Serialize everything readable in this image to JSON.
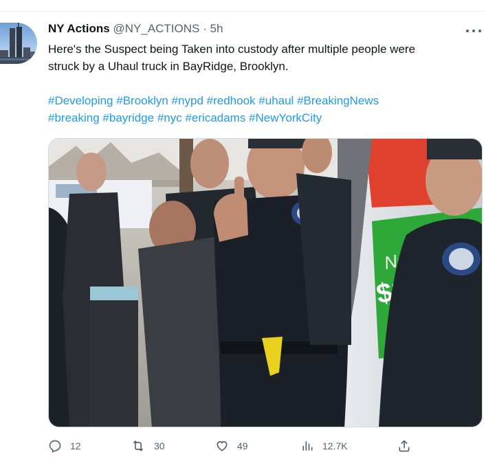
{
  "tweet": {
    "author": {
      "display_name": "NY Actions",
      "handle": "@NY_ACTIONS",
      "separator": "·",
      "time": "5h"
    },
    "text_lines": [
      "Here's the Suspect being Taken into custody after multiple people were",
      "struck by a Uhaul truck in BayRidge, Brooklyn."
    ],
    "hashtags_line1": [
      "#Developing",
      "#Brooklyn",
      "#nypd",
      "#redhook",
      "#uhaul",
      "#BreakingNews"
    ],
    "hashtags_line2": [
      "#breaking",
      "#bayridge",
      "#nyc",
      "#ericadams",
      "#NewYorkCity"
    ],
    "media": {
      "truck_text": "Now On",
      "truck_text_2": "$19"
    },
    "actions": {
      "replies": "12",
      "retweets": "30",
      "likes": "49",
      "views": "12.7K"
    },
    "icons": [
      "reply-icon",
      "retweet-icon",
      "like-icon",
      "views-icon",
      "share-icon",
      "more-icon"
    ],
    "colors": {
      "link": "#1d9bf0",
      "secondary_text": "#536471",
      "primary_text": "#0f1419"
    }
  }
}
